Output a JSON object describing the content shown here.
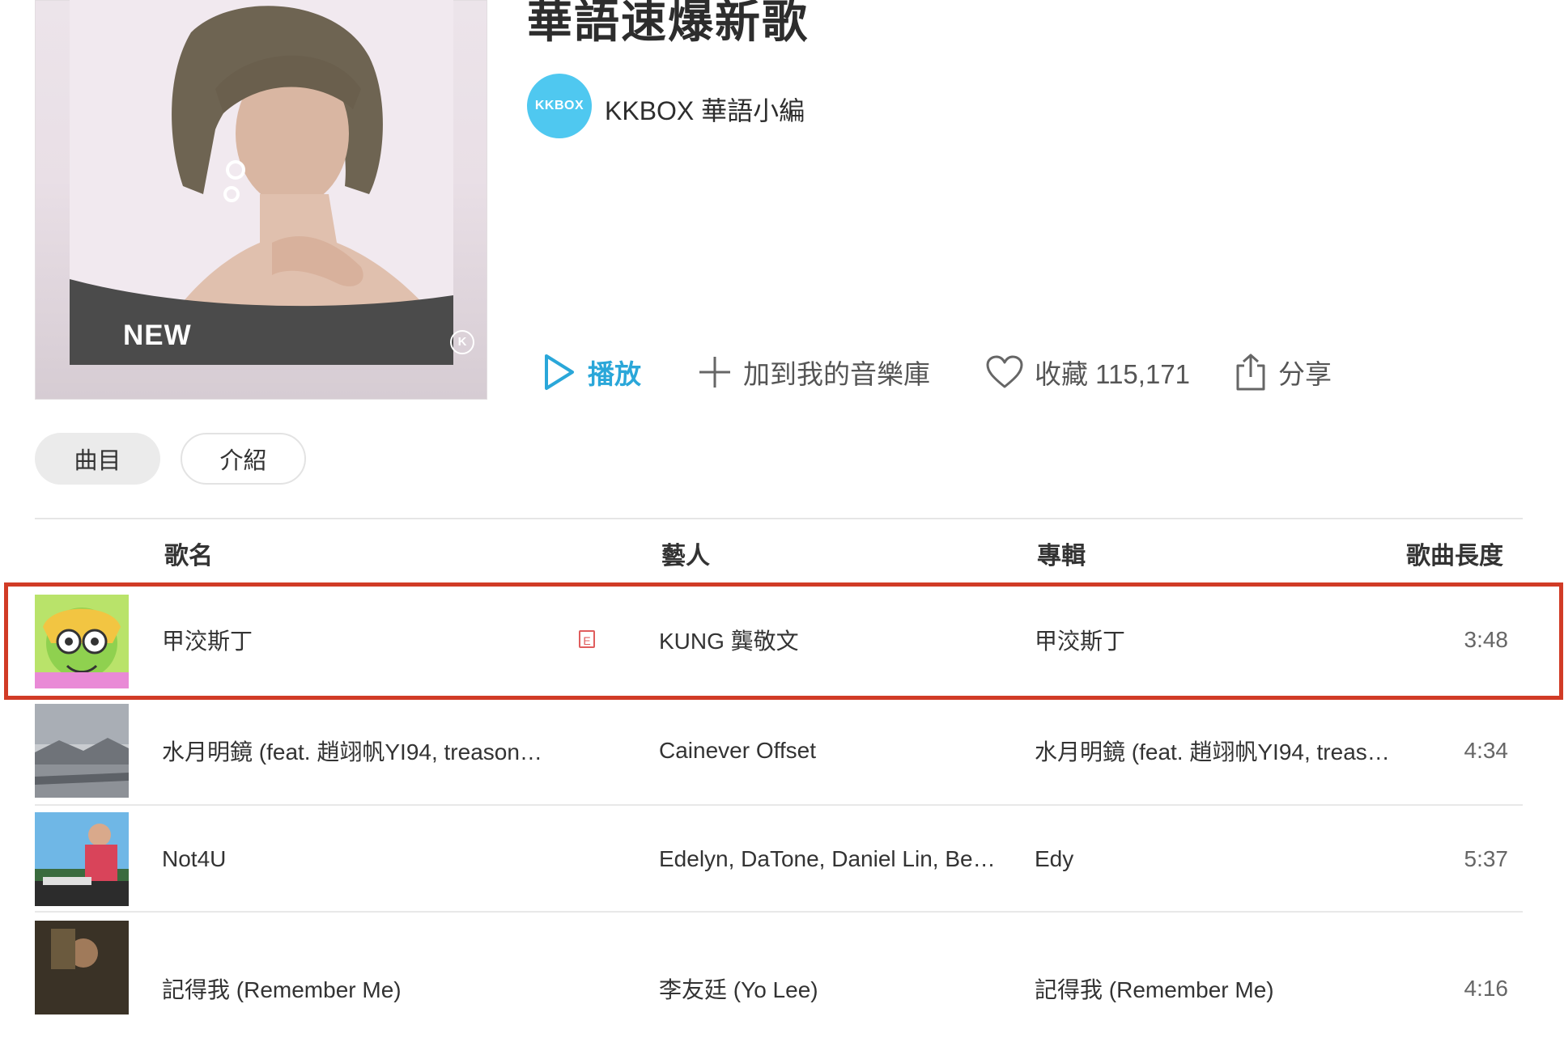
{
  "playlist": {
    "title": "華語速爆新歌",
    "cover_badge": "NEW",
    "cover_logo_letter": "K",
    "owner_logo_text": "KKBOX",
    "owner_name": "KKBOX 華語小編"
  },
  "actions": {
    "play": "播放",
    "add_to_library": "加到我的音樂庫",
    "favorite": "收藏 115,171",
    "share": "分享"
  },
  "tabs": {
    "songs": "曲目",
    "intro": "介紹"
  },
  "table": {
    "headers": {
      "song": "歌名",
      "artist": "藝人",
      "album": "專輯",
      "length": "歌曲長度"
    },
    "rows": [
      {
        "song": "甲洨斯丁",
        "explicit": "E",
        "artist": "KUNG 龔敬文",
        "album": "甲洨斯丁",
        "length": "3:48"
      },
      {
        "song": "水月明鏡 (feat. 趙翊帆YI94, treason…",
        "artist": "Cainever Offset",
        "album": "水月明鏡 (feat. 趙翊帆YI94, treas…",
        "length": "4:34"
      },
      {
        "song": "Not4U",
        "artist": "Edelyn, DaTone, Daniel Lin, Be…",
        "album": "Edy",
        "length": "5:37"
      },
      {
        "song": "記得我 (Remember Me)",
        "artist": "李友廷 (Yo Lee)",
        "album": "記得我 (Remember Me)",
        "length": "4:16"
      }
    ]
  },
  "colors": {
    "accent": "#2aa7d9",
    "highlight": "#d13b26",
    "kkbox_logo": "#4fc8f0"
  },
  "icons": {
    "play": "play-icon",
    "add": "plus-icon",
    "favorite": "heart-icon",
    "share": "share-icon"
  }
}
